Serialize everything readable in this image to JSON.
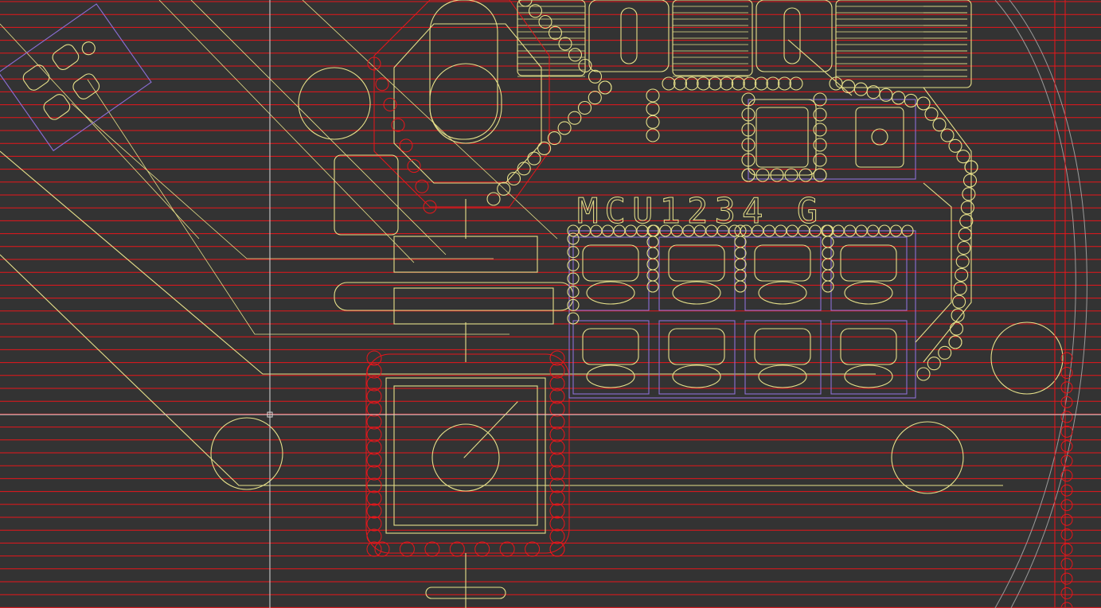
{
  "view": {
    "background": "#333333",
    "colors": {
      "copper_fill": "#e8161b",
      "silkscreen": "#e6e08a",
      "keepout": "#8b6fd6",
      "outline": "#9a9a9a",
      "cursor": "#d8d8d8"
    }
  },
  "board": {
    "silk_text": "MCU1234 G"
  }
}
